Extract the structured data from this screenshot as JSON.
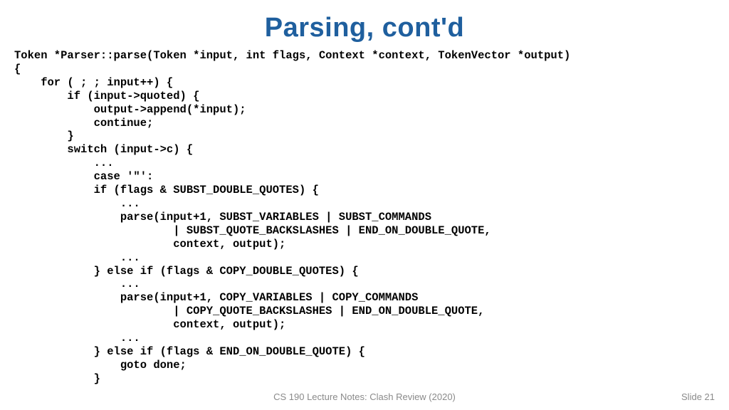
{
  "title": "Parsing, cont'd",
  "code": "Token *Parser::parse(Token *input, int flags, Context *context, TokenVector *output)\n{\n    for ( ; ; input++) {\n        if (input->quoted) {\n            output->append(*input);\n            continue;\n        }\n        switch (input->c) {\n            ...\n            case '\"':\n            if (flags & SUBST_DOUBLE_QUOTES) {\n                ...\n                parse(input+1, SUBST_VARIABLES | SUBST_COMMANDS\n                        | SUBST_QUOTE_BACKSLASHES | END_ON_DOUBLE_QUOTE,\n                        context, output);\n                ...\n            } else if (flags & COPY_DOUBLE_QUOTES) {\n                ...\n                parse(input+1, COPY_VARIABLES | COPY_COMMANDS\n                        | COPY_QUOTE_BACKSLASHES | END_ON_DOUBLE_QUOTE,\n                        context, output);\n                ...\n            } else if (flags & END_ON_DOUBLE_QUOTE) {\n                goto done;\n            }",
  "footer": {
    "center": "CS 190 Lecture Notes: Clash Review (2020)",
    "right": "Slide 21"
  }
}
